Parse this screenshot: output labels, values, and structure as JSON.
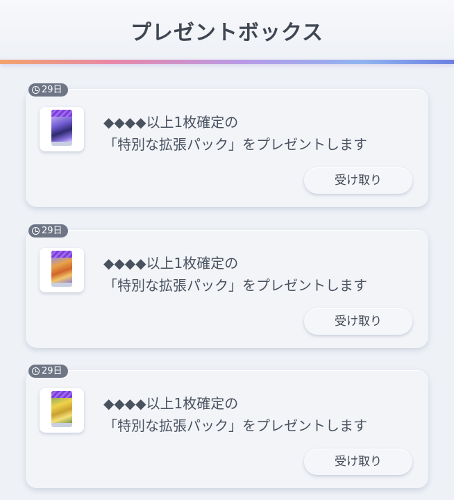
{
  "header": {
    "title": "プレゼントボックス"
  },
  "gifts": [
    {
      "days_left": "29日",
      "line1": "◆◆◆◆以上1枚確定の",
      "line2": "「特別な拡張パック」をプレゼントします",
      "button": "受け取り",
      "pack_icon": "booster-pack-purple-icon"
    },
    {
      "days_left": "29日",
      "line1": "◆◆◆◆以上1枚確定の",
      "line2": "「特別な拡張パック」をプレゼントします",
      "button": "受け取り",
      "pack_icon": "booster-pack-orange-icon"
    },
    {
      "days_left": "29日",
      "line1": "◆◆◆◆以上1枚確定の",
      "line2": "「特別な拡張パック」をプレゼントします",
      "button": "受け取り",
      "pack_icon": "booster-pack-yellow-icon"
    }
  ],
  "colors": {
    "accent_gradient": [
      "#f2a36a",
      "#e887a8",
      "#b59be8",
      "#8fb3f0",
      "#6b7fe0"
    ],
    "badge_bg": "#6e7686",
    "text": "#4a5260"
  }
}
